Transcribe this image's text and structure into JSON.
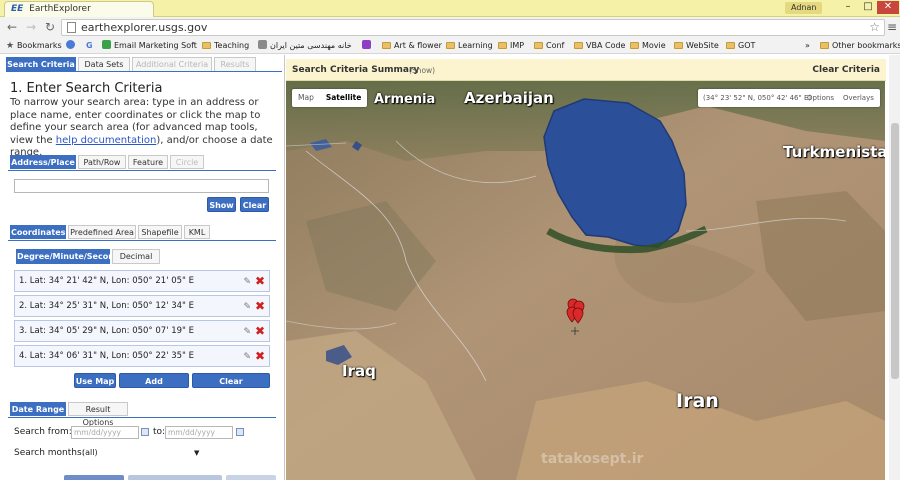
{
  "browser": {
    "tab_title": "EarthExplorer",
    "tab_favicon": "EE",
    "user_badge": "Adnan",
    "url": "earthexplorer.usgs.gov",
    "window_buttons": {
      "minimize": "–",
      "maximize": "□",
      "close": "✕"
    }
  },
  "bookmarks": {
    "items": [
      {
        "label": "Bookmarks",
        "icon": "star-icon"
      },
      {
        "label": "",
        "icon": "sync-icon"
      },
      {
        "label": "",
        "icon": "google-icon"
      },
      {
        "label": "Email Marketing Soft",
        "icon": "page-icon"
      },
      {
        "label": "Teaching",
        "icon": "folder-icon"
      },
      {
        "label": "خانه مهندسی متین ایران",
        "icon": "page-icon"
      },
      {
        "label": "",
        "icon": "page-icon"
      },
      {
        "label": "Art & flower",
        "icon": "folder-icon"
      },
      {
        "label": "Learning",
        "icon": "folder-icon"
      },
      {
        "label": "IMP",
        "icon": "folder-icon"
      },
      {
        "label": "Conf",
        "icon": "folder-icon"
      },
      {
        "label": "VBA Code",
        "icon": "folder-icon"
      },
      {
        "label": "Movie",
        "icon": "folder-icon"
      },
      {
        "label": "WebSite",
        "icon": "folder-icon"
      },
      {
        "label": "GOT",
        "icon": "folder-icon"
      }
    ],
    "overflow": "»",
    "other": "Other bookmarks"
  },
  "left": {
    "tabs": [
      "Search Criteria",
      "Data Sets",
      "Additional Criteria",
      "Results"
    ],
    "heading": "1. Enter Search Criteria",
    "instructions_pre": "To narrow your search area: type in an address or place name, enter coordinates or click the map to define your search area (for advanced map tools, view the ",
    "instructions_link": "help documentation",
    "instructions_post": "), and/or choose a date range.",
    "address_tabs": [
      "Address/Place",
      "Path/Row",
      "Feature",
      "Circle"
    ],
    "address_value": "",
    "show_button": "Show",
    "clear_button": "Clear",
    "coord_tabs": [
      "Coordinates",
      "Predefined Area",
      "Shapefile",
      "KML"
    ],
    "format_tabs": [
      "Degree/Minute/Second",
      "Decimal"
    ],
    "coordinates": [
      "1.  Lat: 34° 21' 42\" N, Lon: 050° 21' 05\" E",
      "2.  Lat: 34° 25' 31\" N, Lon: 050° 12' 34\" E",
      "3.  Lat: 34° 05' 29\" N, Lon: 050° 07' 19\" E",
      "4.  Lat: 34° 06' 31\" N, Lon: 050° 22' 35\" E"
    ],
    "use_map_button": "Use Map",
    "add_coordinate_button": "Add Coordinate",
    "clear_coordinates_button": "Clear Coordinates",
    "date_tabs": [
      "Date Range",
      "Result Options"
    ],
    "search_from_label": "Search from:",
    "date_placeholder": "mm/dd/yyyy",
    "to_label": "to:",
    "search_months_label": "Search months:",
    "search_months_value": "(all)"
  },
  "right": {
    "summary_title": "Search Criteria Summary",
    "summary_show": "(Show)",
    "clear_criteria": "Clear Criteria",
    "map_types": [
      "Map",
      "Satellite"
    ],
    "map_coords": "(34° 23' 52\" N, 050° 42' 46\" E)",
    "options": "Options",
    "overlays": "Overlays",
    "labels": [
      "Armenia",
      "Azerbaijan",
      "Turkmenista",
      "Iraq",
      "Iran"
    ],
    "watermark": "tatakosept.ir"
  },
  "colors": {
    "accent": "#3c6fc1",
    "delete": "#d02020",
    "titlebar": "#f5f1a6",
    "summary_bar": "#fbf4cf",
    "caspian": "#2c4f9a"
  }
}
